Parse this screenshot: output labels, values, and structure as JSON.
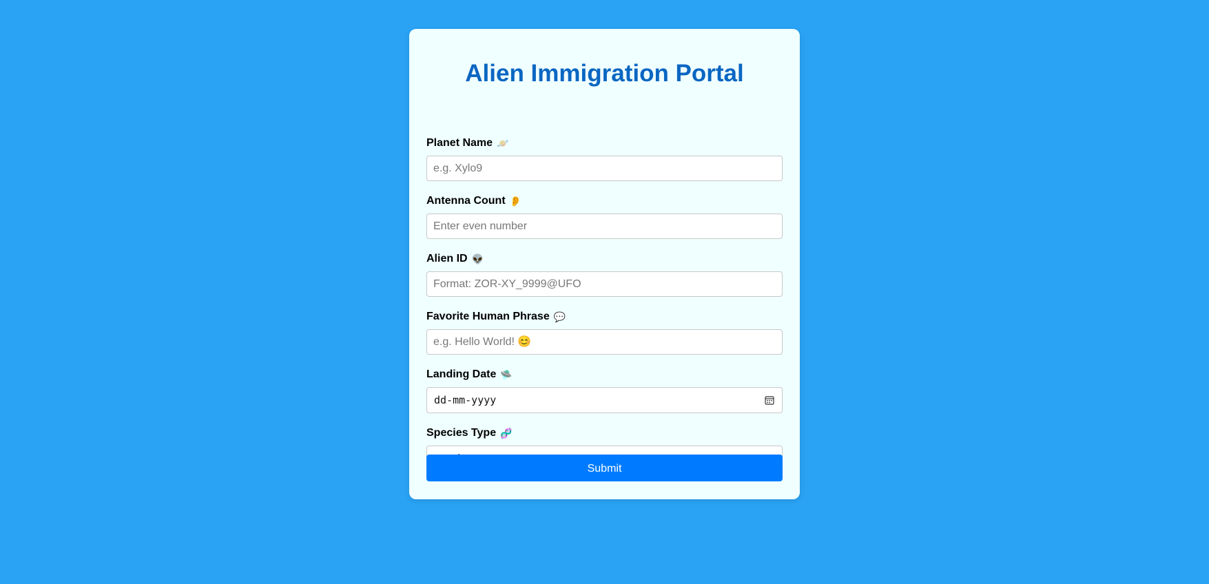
{
  "title": "Alien Immigration Portal",
  "fields": {
    "planet": {
      "label": "Planet Name",
      "emoji": "🪐",
      "placeholder": "e.g. Xylo9",
      "value": ""
    },
    "antenna": {
      "label": "Antenna Count",
      "emoji": "👂",
      "placeholder": "Enter even number",
      "value": ""
    },
    "alien_id": {
      "label": "Alien ID",
      "emoji": "👽",
      "placeholder": "Format: ZOR-XY_9999@UFO",
      "value": ""
    },
    "phrase": {
      "label": "Favorite Human Phrase",
      "emoji": "💬",
      "placeholder": "e.g. Hello World! 😊",
      "value": ""
    },
    "landing": {
      "label": "Landing Date",
      "emoji": "🛸",
      "value": "dd-mm-yyyy"
    },
    "species": {
      "label": "Species Type",
      "emoji": "🧬",
      "selected": "-- Select Your Type --"
    }
  },
  "submit_label": "Submit",
  "icons": {
    "calendar": "calendar-icon",
    "dropdown": "chevron-down-icon"
  },
  "colors": {
    "background": "#2aa3f5",
    "card": "#f0ffff",
    "title": "#0a66c2",
    "button": "#007bff"
  }
}
